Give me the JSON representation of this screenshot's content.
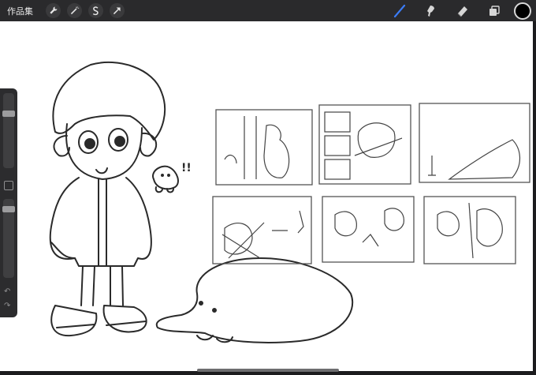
{
  "topbar": {
    "gallery_label": "作品集",
    "tools_left": [
      "wrench-icon",
      "magic-wand-icon",
      "selection-icon",
      "transform-arrow-icon"
    ],
    "tools_right": [
      "brush-icon",
      "smudge-icon",
      "eraser-icon",
      "layers-icon"
    ],
    "current_color": "#000000",
    "active_tool_color": "#3b7cf6"
  },
  "sidebar": {
    "brush_size_level": 0.25,
    "opacity_level": 0.1
  },
  "canvas": {
    "background": "#ffffff",
    "annotation_text": "!!"
  }
}
